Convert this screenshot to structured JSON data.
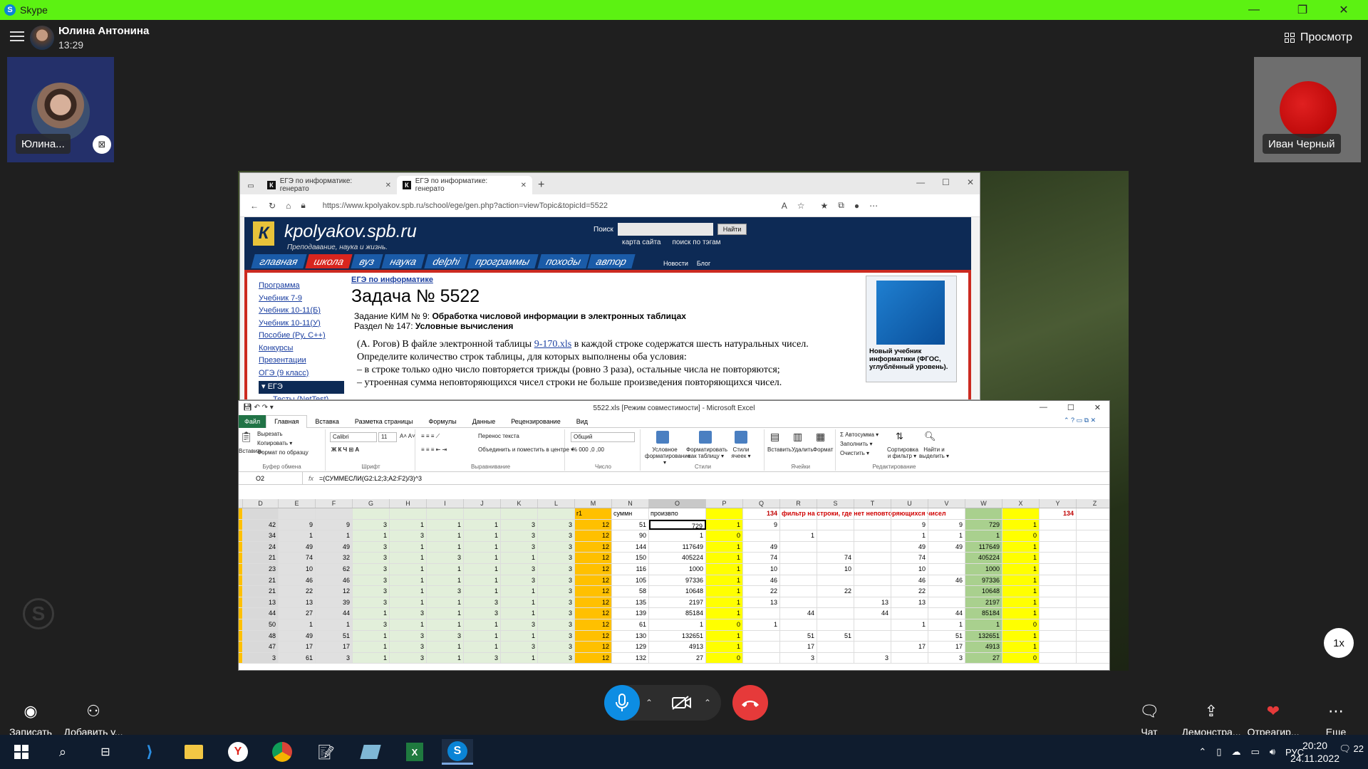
{
  "window": {
    "title": "Skype",
    "minimize": "—",
    "restore": "❐",
    "close": "✕"
  },
  "call": {
    "caller_name": "Юлина Антонина",
    "time": "13:29",
    "preview_label": "Просмотр"
  },
  "tiles": {
    "self_label": "Юлина...",
    "remote_label": "Иван Черный"
  },
  "browser": {
    "tabs": [
      "ЕГЭ по информатике: генерато",
      "ЕГЭ по информатике: генерато"
    ],
    "url": "https://www.kpolyakov.spb.ru/school/ege/gen.php?action=viewTopic&topicId=5522"
  },
  "site": {
    "logo": "К",
    "title": "kpolyakov.spb.ru",
    "slogan": "Преподавание, наука и жизнь.",
    "search_label": "Поиск",
    "search_btn": "Найти",
    "links": [
      "карта сайта",
      "поиск по тэгам"
    ],
    "nav": [
      "главная",
      "школа",
      "вуз",
      "наука",
      "delphi",
      "программы",
      "походы",
      "автор"
    ],
    "news": [
      "Новости",
      "Блог"
    ],
    "sidebar": [
      "Программа",
      "Учебник 7-9",
      "Учебник 10-11(Б)",
      "Учебник 10-11(У)",
      "Пособие (Py, C++)",
      "Конкурсы",
      "Презентации",
      "ОГЭ (9 класс)",
      "▾ ЕГЭ",
      "Тесты (NetTest)"
    ],
    "breadcrumb": "ЕГЭ по информатике",
    "task_title": "Задача № 5522",
    "meta1_a": "Задание КИМ № 9: ",
    "meta1_b": "Обработка числовой информации в электронных таблицах",
    "meta2_a": "Раздел № 147: ",
    "meta2_b": "Условные вычисления",
    "text_pre": "(А. Рогов) В файле электронной таблицы ",
    "text_link": "9-170.xls",
    "text_post": " в каждой строке содержатся шесть натуральных чисел. Определите количество строк таблицы, для которых выполнены оба условия:",
    "text_l1": "– в строке только одно число повторяется трижды (ровно 3 раза), остальные числа не повторяются;",
    "text_l2": "– утроенная сумма неповторяющихся чисел строки не больше произведения повторяющихся чисел.",
    "book_caption": "Новый учебник информатики (ФГОС, углублённый уровень)."
  },
  "excel": {
    "title": "5522.xls  [Режим совместимости] - Microsoft Excel",
    "tabs": [
      "Файл",
      "Главная",
      "Вставка",
      "Разметка страницы",
      "Формулы",
      "Данные",
      "Рецензирование",
      "Вид"
    ],
    "ribbon": {
      "cut": "Вырезать",
      "copy": "Копировать ▾",
      "format_painter": "Формат по образцу",
      "paste": "Вставить",
      "font": "Calibri",
      "size": "11",
      "wrap": "Перенос текста",
      "merge": "Объединить и поместить в центре ▾",
      "num_format": "Общий",
      "cond": "Условное форматирование ▾",
      "as_table": "Форматировать как таблицу ▾",
      "cell_styles": "Стили ячеек ▾",
      "insert": "Вставить",
      "delete": "Удалить",
      "format": "Формат",
      "autosum": "Σ Автосумма ▾",
      "fill": "Заполнить ▾",
      "clear": "Очистить ▾",
      "sort": "Сортировка и фильтр ▾",
      "find": "Найти и выделить ▾",
      "groups": [
        "Буфер обмена",
        "Шрифт",
        "Выравнивание",
        "Число",
        "Стили",
        "Ячейки",
        "Редактирование"
      ]
    },
    "namebox": "O2",
    "fx": "fx",
    "formula": "=(СУММЕСЛИ(G2:L2;3;A2:F2)/3)^3",
    "columns": [
      "D",
      "E",
      "F",
      "G",
      "H",
      "I",
      "J",
      "K",
      "L",
      "M",
      "N",
      "O",
      "P",
      "Q",
      "R",
      "S",
      "T",
      "U",
      "V",
      "W",
      "X",
      "Y",
      "Z"
    ],
    "header_row": [
      "",
      "",
      "",
      "",
      "",
      "",
      "",
      "",
      "",
      "r1",
      "суммн",
      "произвпо",
      "",
      "134",
      "фильтр на строки, где нет неповторяющихся чисел",
      "",
      "",
      "",
      "",
      "",
      "",
      "134",
      ""
    ],
    "rows": [
      [
        "42",
        "9",
        "9",
        "3",
        "1",
        "1",
        "1",
        "3",
        "3",
        "12",
        "51",
        "729",
        "1",
        "9",
        "",
        "",
        "",
        "9",
        "9",
        "729",
        "1",
        "",
        ""
      ],
      [
        "34",
        "1",
        "1",
        "1",
        "3",
        "1",
        "1",
        "3",
        "3",
        "12",
        "90",
        "1",
        "0",
        "",
        "1",
        "",
        "",
        "1",
        "1",
        "1",
        "0",
        "",
        ""
      ],
      [
        "24",
        "49",
        "49",
        "3",
        "1",
        "1",
        "1",
        "3",
        "3",
        "12",
        "144",
        "117649",
        "1",
        "49",
        "",
        "",
        "",
        "49",
        "49",
        "117649",
        "1",
        "",
        ""
      ],
      [
        "21",
        "74",
        "32",
        "3",
        "1",
        "3",
        "1",
        "1",
        "3",
        "12",
        "150",
        "405224",
        "1",
        "74",
        "",
        "74",
        "",
        "74",
        "",
        "405224",
        "1",
        "",
        ""
      ],
      [
        "23",
        "10",
        "62",
        "3",
        "1",
        "1",
        "1",
        "3",
        "3",
        "12",
        "116",
        "1000",
        "1",
        "10",
        "",
        "10",
        "",
        "10",
        "",
        "1000",
        "1",
        "",
        ""
      ],
      [
        "21",
        "46",
        "46",
        "3",
        "1",
        "1",
        "1",
        "3",
        "3",
        "12",
        "105",
        "97336",
        "1",
        "46",
        "",
        "",
        "",
        "46",
        "46",
        "97336",
        "1",
        "",
        ""
      ],
      [
        "21",
        "22",
        "12",
        "3",
        "1",
        "3",
        "1",
        "1",
        "3",
        "12",
        "58",
        "10648",
        "1",
        "22",
        "",
        "22",
        "",
        "22",
        "",
        "10648",
        "1",
        "",
        ""
      ],
      [
        "13",
        "13",
        "39",
        "3",
        "1",
        "1",
        "3",
        "1",
        "3",
        "12",
        "135",
        "2197",
        "1",
        "13",
        "",
        "",
        "13",
        "13",
        "",
        "2197",
        "1",
        "",
        ""
      ],
      [
        "44",
        "27",
        "44",
        "1",
        "3",
        "1",
        "3",
        "1",
        "3",
        "12",
        "139",
        "85184",
        "1",
        "",
        "44",
        "",
        "44",
        "",
        "44",
        "85184",
        "1",
        "",
        ""
      ],
      [
        "50",
        "1",
        "1",
        "3",
        "1",
        "1",
        "1",
        "3",
        "3",
        "12",
        "61",
        "1",
        "0",
        "1",
        "",
        "",
        "",
        "1",
        "1",
        "1",
        "0",
        "",
        ""
      ],
      [
        "48",
        "49",
        "51",
        "1",
        "3",
        "3",
        "1",
        "1",
        "3",
        "12",
        "130",
        "132651",
        "1",
        "",
        "51",
        "51",
        "",
        "",
        "51",
        "132651",
        "1",
        "",
        ""
      ],
      [
        "47",
        "17",
        "17",
        "1",
        "3",
        "1",
        "1",
        "3",
        "3",
        "12",
        "129",
        "4913",
        "1",
        "",
        "17",
        "",
        "",
        "17",
        "17",
        "4913",
        "1",
        "",
        ""
      ],
      [
        "3",
        "61",
        "3",
        "1",
        "3",
        "1",
        "3",
        "1",
        "3",
        "12",
        "132",
        "27",
        "0",
        "",
        "3",
        "",
        "3",
        "",
        "3",
        "27",
        "0",
        "",
        ""
      ]
    ]
  },
  "controls": {
    "record": "Записать",
    "add": "Добавить у...",
    "chat": "Чат",
    "share": "Демонстра...",
    "react": "Отреагир...",
    "more": "Еще",
    "speed": "1x"
  },
  "taskbar": {
    "lang": "РУС",
    "time": "20:20",
    "date": "24.11.2022",
    "notif": "22"
  },
  "colors": {
    "accent": "#5cf212",
    "mic": "#0d8de3",
    "hangup": "#e63a3a"
  }
}
